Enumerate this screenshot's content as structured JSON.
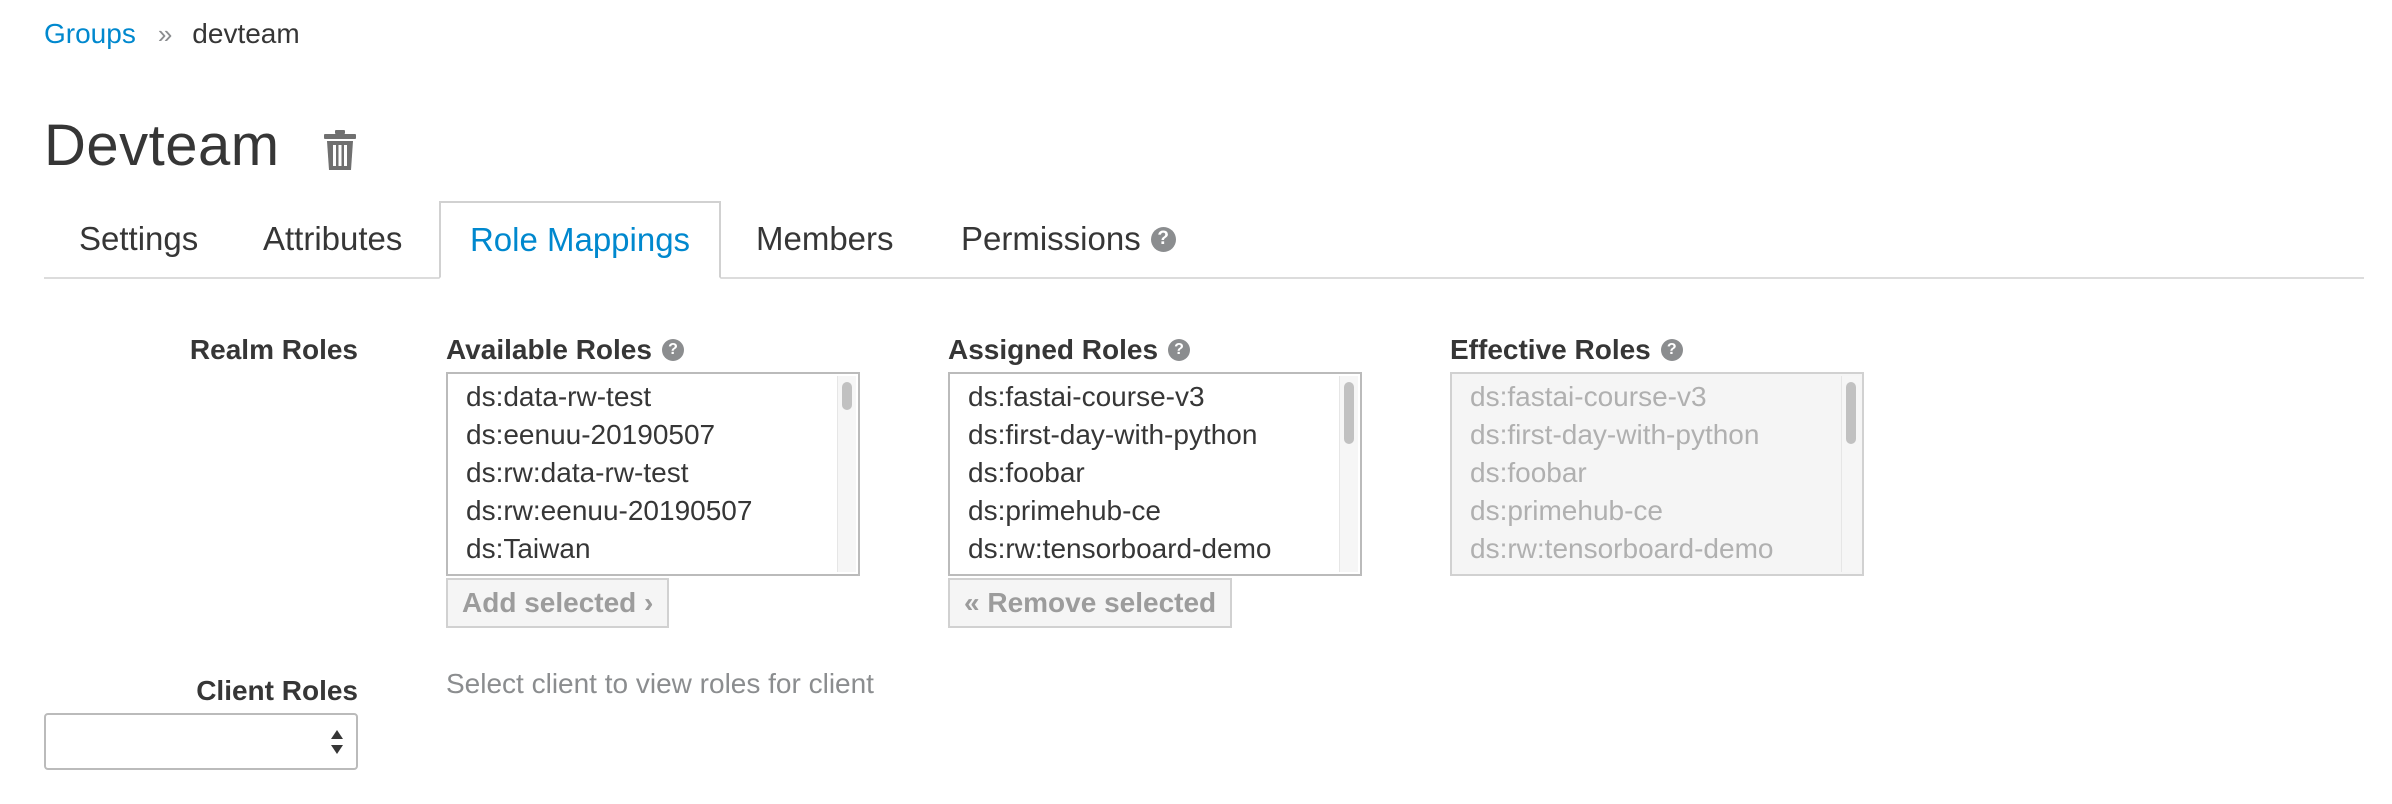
{
  "breadcrumb": {
    "parent": "Groups",
    "separator": "»",
    "current": "devteam"
  },
  "page": {
    "title": "Devteam"
  },
  "tabs": [
    {
      "label": "Settings"
    },
    {
      "label": "Attributes"
    },
    {
      "label": "Role Mappings",
      "active": true
    },
    {
      "label": "Members"
    },
    {
      "label": "Permissions"
    }
  ],
  "realm_roles": {
    "label": "Realm Roles",
    "available": {
      "label": "Available Roles",
      "items": [
        "ds:data-rw-test",
        "ds:eenuu-20190507",
        "ds:rw:data-rw-test",
        "ds:rw:eenuu-20190507",
        "ds:Taiwan"
      ],
      "button": "Add selected ›"
    },
    "assigned": {
      "label": "Assigned Roles",
      "items": [
        "ds:fastai-course-v3",
        "ds:first-day-with-python",
        "ds:foobar",
        "ds:primehub-ce",
        "ds:rw:tensorboard-demo"
      ],
      "button": "« Remove selected"
    },
    "effective": {
      "label": "Effective Roles",
      "items": [
        "ds:fastai-course-v3",
        "ds:first-day-with-python",
        "ds:foobar",
        "ds:primehub-ce",
        "ds:rw:tensorboard-demo"
      ]
    }
  },
  "client_roles": {
    "label": "Client Roles",
    "hint": "Select client to view roles for client",
    "select_value": ""
  },
  "colors": {
    "link": "#0088ce",
    "text": "#363636",
    "muted": "#8b8d8f"
  }
}
